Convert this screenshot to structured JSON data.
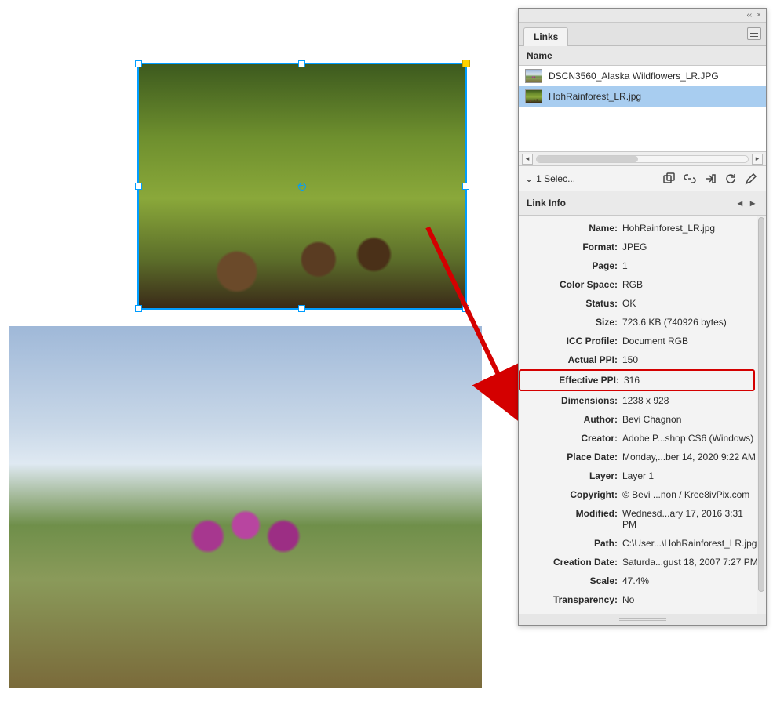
{
  "panel": {
    "tab_label": "Links",
    "column_header": "Name",
    "items": [
      {
        "filename": "DSCN3560_Alaska Wildflowers_LR.JPG",
        "thumb_class": "thumb-wild"
      },
      {
        "filename": "HohRainforest_LR.jpg",
        "thumb_class": "thumb-forest"
      }
    ],
    "selection_summary": "1 Selec...",
    "section_title": "Link Info"
  },
  "icons": {
    "collapse": "‹‹",
    "close": "×",
    "dropdown": "⌄",
    "prev": "◂",
    "next": "▸",
    "scroll_left": "◂",
    "scroll_right": "▸"
  },
  "link_info": [
    {
      "label": "Name:",
      "value": "HohRainforest_LR.jpg"
    },
    {
      "label": "Format:",
      "value": "JPEG"
    },
    {
      "label": "Page:",
      "value": "1"
    },
    {
      "label": "Color Space:",
      "value": "RGB"
    },
    {
      "label": "Status:",
      "value": "OK"
    },
    {
      "label": "Size:",
      "value": "723.6 KB (740926 bytes)"
    },
    {
      "label": "ICC Profile:",
      "value": "Document RGB"
    },
    {
      "label": "Actual PPI:",
      "value": "150"
    },
    {
      "label": "Effective PPI:",
      "value": "316",
      "highlight": true
    },
    {
      "label": "Dimensions:",
      "value": "1238 x 928"
    },
    {
      "label": "Author:",
      "value": "Bevi Chagnon"
    },
    {
      "label": "Creator:",
      "value": "Adobe P...shop CS6 (Windows)"
    },
    {
      "label": "Place Date:",
      "value": "Monday,...ber 14, 2020 9:22 AM"
    },
    {
      "label": "Layer:",
      "value": "Layer 1"
    },
    {
      "label": "Copyright:",
      "value": "© Bevi ...non / Kree8ivPix.com"
    },
    {
      "label": "Modified:",
      "value": "Wednesd...ary 17, 2016 3:31 PM"
    },
    {
      "label": "Path:",
      "value": "C:\\User...\\HohRainforest_LR.jpg"
    },
    {
      "label": "Creation Date:",
      "value": "Saturda...gust 18, 2007 7:27 PM"
    },
    {
      "label": "Scale:",
      "value": "47.4%"
    },
    {
      "label": "Transparency:",
      "value": "No"
    }
  ]
}
